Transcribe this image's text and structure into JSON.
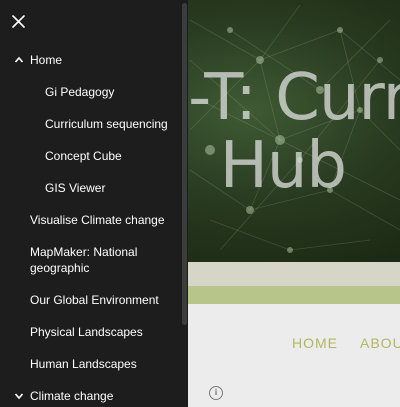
{
  "hero": {
    "title_line1": "-T: Curr",
    "title_line2": "Hub"
  },
  "nav": {
    "home": "HOME",
    "about": "ABOU"
  },
  "drawer": {
    "items": [
      {
        "label": "Home",
        "expanded": true,
        "level": 0,
        "icon": "chevron-up-icon"
      },
      {
        "label": "Gi Pedagogy",
        "level": 1
      },
      {
        "label": "Curriculum sequencing",
        "level": 1
      },
      {
        "label": "Concept Cube",
        "level": 1
      },
      {
        "label": "GIS Viewer",
        "level": 1
      },
      {
        "label": "Visualise Climate change",
        "level": 0
      },
      {
        "label": "MapMaker: National",
        "label2": "geographic",
        "level": 0
      },
      {
        "label": "Our Global Environment",
        "level": 0
      },
      {
        "label": "Physical Landscapes",
        "level": 0
      },
      {
        "label": "Human Landscapes",
        "level": 0
      },
      {
        "label": "Climate change",
        "expanded": false,
        "level": 0,
        "icon": "chevron-down-icon"
      }
    ]
  },
  "colors": {
    "drawer_bg": "#1d1d1d",
    "nav_accent": "#b0b760",
    "olive_bar": "#b7c48a"
  }
}
